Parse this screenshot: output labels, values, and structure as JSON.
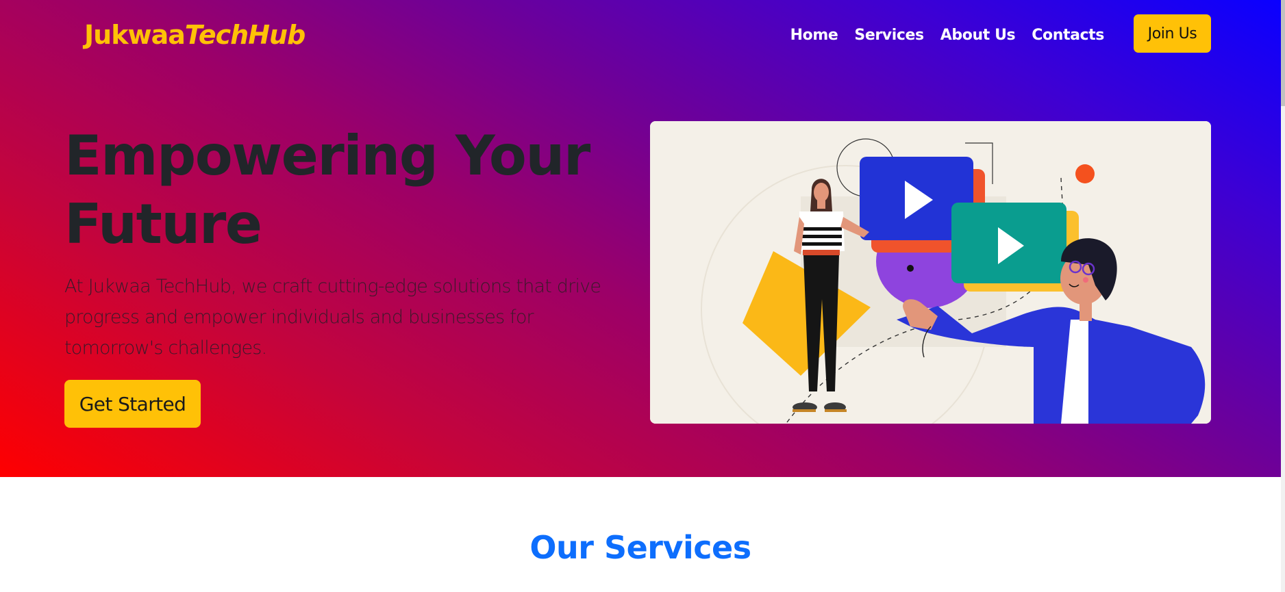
{
  "navbar": {
    "brand_part1": "Jukwaa",
    "brand_part2": "TechHub",
    "links": [
      "Home",
      "Services",
      "About Us",
      "Contacts"
    ],
    "join_label": "Join Us"
  },
  "hero": {
    "title_line1": "Empowering Your",
    "title_line2": "Future",
    "description": "At Jukwaa TechHub, we craft cutting-edge solutions that drive progress and empower individuals and businesses for tomorrow's challenges.",
    "cta_label": "Get Started",
    "illustration_alt": "people-with-video-play-cards-illustration"
  },
  "services": {
    "title": "Our Services"
  },
  "colors": {
    "brand_yellow": "#ffc107",
    "heading_blue": "#0d6efd",
    "gradient_start": "#ff0000",
    "gradient_end": "#0a00ff"
  }
}
